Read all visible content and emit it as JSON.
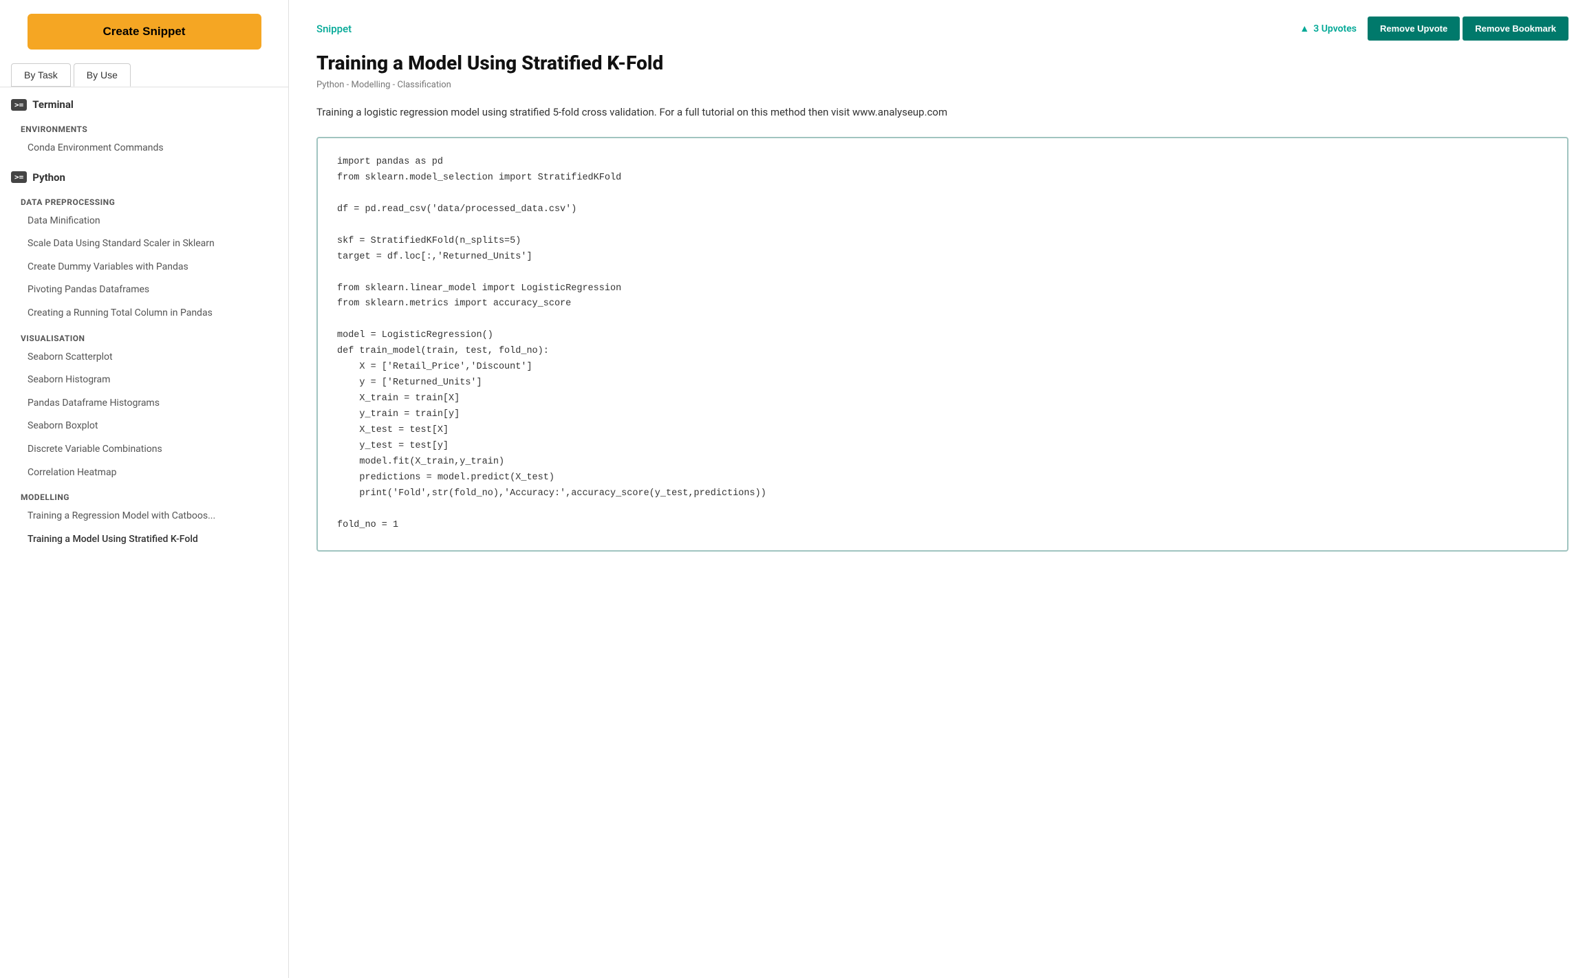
{
  "sidebar": {
    "create_button_label": "Create Snippet",
    "tabs": [
      {
        "id": "by-task",
        "label": "By Task"
      },
      {
        "id": "by-use",
        "label": "By Use"
      }
    ],
    "sections": [
      {
        "id": "terminal",
        "icon": ">= ",
        "label": "Terminal",
        "categories": [
          {
            "id": "environments",
            "label": "ENVIRONMENTS",
            "items": [
              {
                "id": "conda",
                "label": "Conda Environment Commands"
              }
            ]
          }
        ]
      },
      {
        "id": "python",
        "icon": ">= ",
        "label": "Python",
        "categories": [
          {
            "id": "data-preprocessing",
            "label": "DATA PREPROCESSING",
            "items": [
              {
                "id": "data-minification",
                "label": "Data Minification"
              },
              {
                "id": "scale-data",
                "label": "Scale Data Using Standard Scaler in Sklearn"
              },
              {
                "id": "dummy-vars",
                "label": "Create Dummy Variables with Pandas"
              },
              {
                "id": "pivoting",
                "label": "Pivoting Pandas Dataframes"
              },
              {
                "id": "running-total",
                "label": "Creating a Running Total Column in Pandas"
              }
            ]
          },
          {
            "id": "visualisation",
            "label": "VISUALISATION",
            "items": [
              {
                "id": "seaborn-scatter",
                "label": "Seaborn Scatterplot"
              },
              {
                "id": "seaborn-histogram",
                "label": "Seaborn Histogram"
              },
              {
                "id": "pandas-histograms",
                "label": "Pandas Dataframe Histograms"
              },
              {
                "id": "seaborn-boxplot",
                "label": "Seaborn Boxplot"
              },
              {
                "id": "discrete-vars",
                "label": "Discrete Variable Combinations"
              },
              {
                "id": "correlation-heatmap",
                "label": "Correlation Heatmap"
              }
            ]
          },
          {
            "id": "modelling",
            "label": "MODELLING",
            "items": [
              {
                "id": "catboost",
                "label": "Training a Regression Model with Catboos..."
              },
              {
                "id": "stratified-kfold",
                "label": "Training a Model Using Stratified K-Fold"
              }
            ]
          }
        ]
      }
    ]
  },
  "main": {
    "snippet_label": "Snippet",
    "upvotes_count": "3 Upvotes",
    "remove_upvote_label": "Remove Upvote",
    "remove_bookmark_label": "Remove Bookmark",
    "title": "Training a Model Using Stratified K-Fold",
    "meta": "Python - Modelling - Classification",
    "description": "Training a logistic regression model using stratified 5-fold cross validation. For a full tutorial on this method then visit www.analyseup.com",
    "code": "import pandas as pd\nfrom sklearn.model_selection import StratifiedKFold\n\ndf = pd.read_csv('data/processed_data.csv')\n\nskf = StratifiedKFold(n_splits=5)\ntarget = df.loc[:,'Returned_Units']\n\nfrom sklearn.linear_model import LogisticRegression\nfrom sklearn.metrics import accuracy_score\n\nmodel = LogisticRegression()\ndef train_model(train, test, fold_no):\n    X = ['Retail_Price','Discount']\n    y = ['Returned_Units']\n    X_train = train[X]\n    y_train = train[y]\n    X_test = test[X]\n    y_test = test[y]\n    model.fit(X_train,y_train)\n    predictions = model.predict(X_test)\n    print('Fold',str(fold_no),'Accuracy:',accuracy_score(y_test,predictions))\n\nfold_no = 1"
  }
}
